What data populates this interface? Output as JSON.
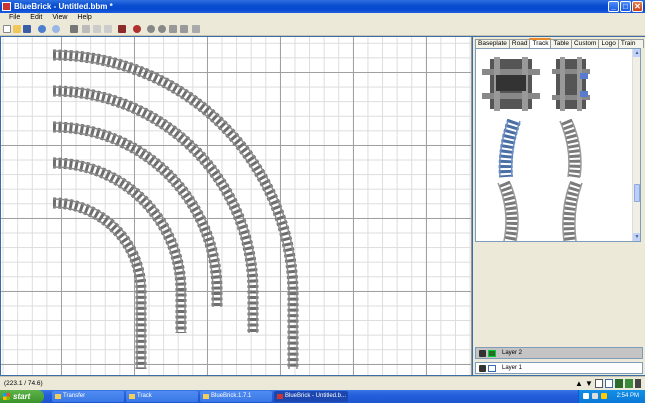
{
  "window": {
    "title": "BlueBrick - Untitled.bbm *",
    "buttons": {
      "minimize": "_",
      "maximize": "□",
      "close": "✕"
    }
  },
  "menu": [
    "File",
    "Edit",
    "View",
    "Help"
  ],
  "library": {
    "tabs": [
      "Baseplate",
      "Road",
      "Track",
      "Table",
      "Custom",
      "Logo",
      "Train Set"
    ],
    "active_tab": "Track",
    "scroll_up": "▲",
    "scroll_down": "▼"
  },
  "layers": [
    {
      "name": "Layer 2",
      "type": "brick",
      "selected": true
    },
    {
      "name": "Layer 1",
      "type": "grid",
      "selected": false
    }
  ],
  "status": {
    "coordinates": "(223.1 / 74.6)",
    "icons": [
      "arrow-up-icon",
      "arrow-down-icon",
      "text-layer-icon",
      "grid-layer-icon",
      "brick-layer-icon",
      "area-layer-icon",
      "trash-icon"
    ]
  },
  "taskbar": {
    "start_label": "start",
    "tasks": [
      {
        "label": "Transfer",
        "active": false
      },
      {
        "label": "Track",
        "active": false
      },
      {
        "label": "BlueBrick.1.7.1",
        "active": false
      },
      {
        "label": "BlueBrick - Untitled.b...",
        "active": true
      }
    ],
    "clock": "2:54 PM"
  },
  "colors": {
    "titlebar": "#0a4fd1",
    "track_rail": "#7a7a7a",
    "track_tie": "#6e6e6e",
    "library_blue_track": "#4a6fa5",
    "taskbar": "#245edb",
    "start": "#3a932a",
    "active_tab_accent": "#e68b2c"
  }
}
